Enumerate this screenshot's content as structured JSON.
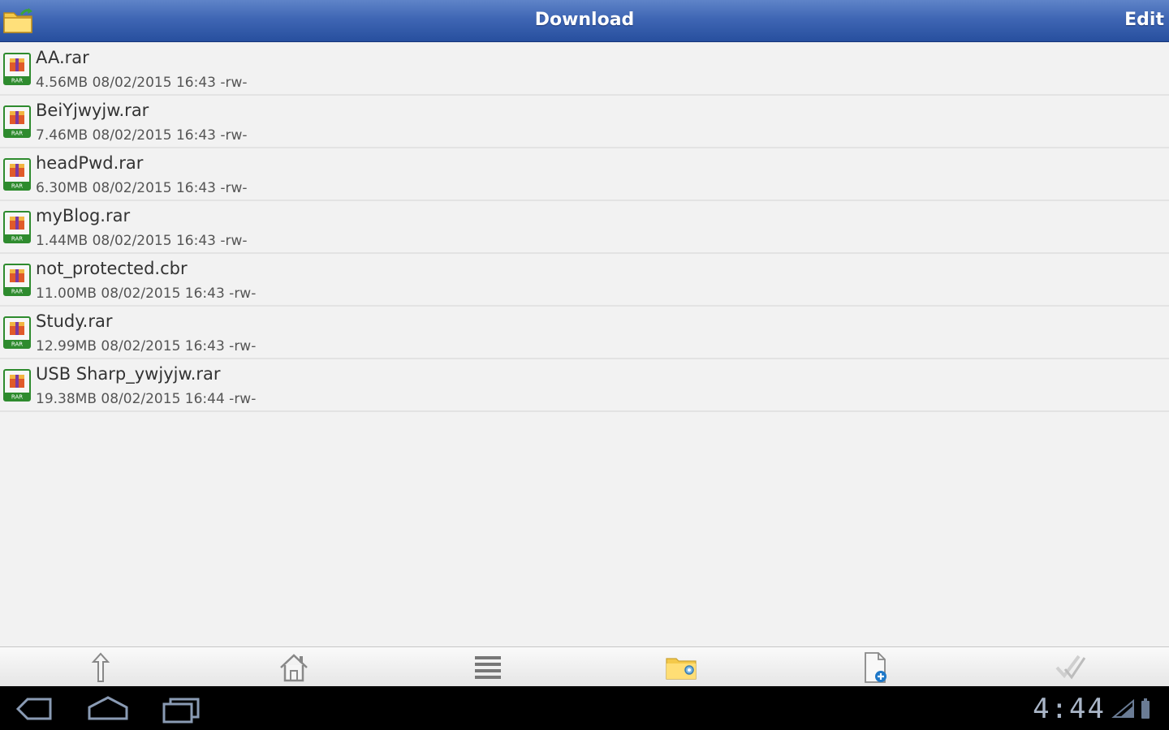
{
  "header": {
    "title": "Download",
    "edit_label": "Edit",
    "folder_icon": "folder-icon"
  },
  "files": [
    {
      "name": "AA.rar",
      "meta": "4.56MB 08/02/2015 16:43 -rw-"
    },
    {
      "name": "BeiYjwyjw.rar",
      "meta": "7.46MB 08/02/2015 16:43 -rw-"
    },
    {
      "name": "headPwd.rar",
      "meta": "6.30MB 08/02/2015 16:43 -rw-"
    },
    {
      "name": "myBlog.rar",
      "meta": "1.44MB 08/02/2015 16:43 -rw-"
    },
    {
      "name": "not_protected.cbr",
      "meta": "11.00MB 08/02/2015 16:43 -rw-"
    },
    {
      "name": "Study.rar",
      "meta": "12.99MB 08/02/2015 16:43 -rw-"
    },
    {
      "name": "USB Sharp_ywjyjw.rar",
      "meta": "19.38MB 08/02/2015 16:44 -rw-"
    }
  ],
  "toolbar": {
    "buttons": [
      "up-arrow-icon",
      "home-icon",
      "list-icon",
      "folder-settings-icon",
      "new-file-icon",
      "checkmark-icon"
    ]
  },
  "system": {
    "clock": "4:44",
    "nav_buttons": [
      "back-icon",
      "home-icon",
      "recent-apps-icon"
    ]
  },
  "colors": {
    "header_blue": "#3f66b4",
    "background": "#f2f2f2",
    "rar_green": "#2e8b2e"
  }
}
